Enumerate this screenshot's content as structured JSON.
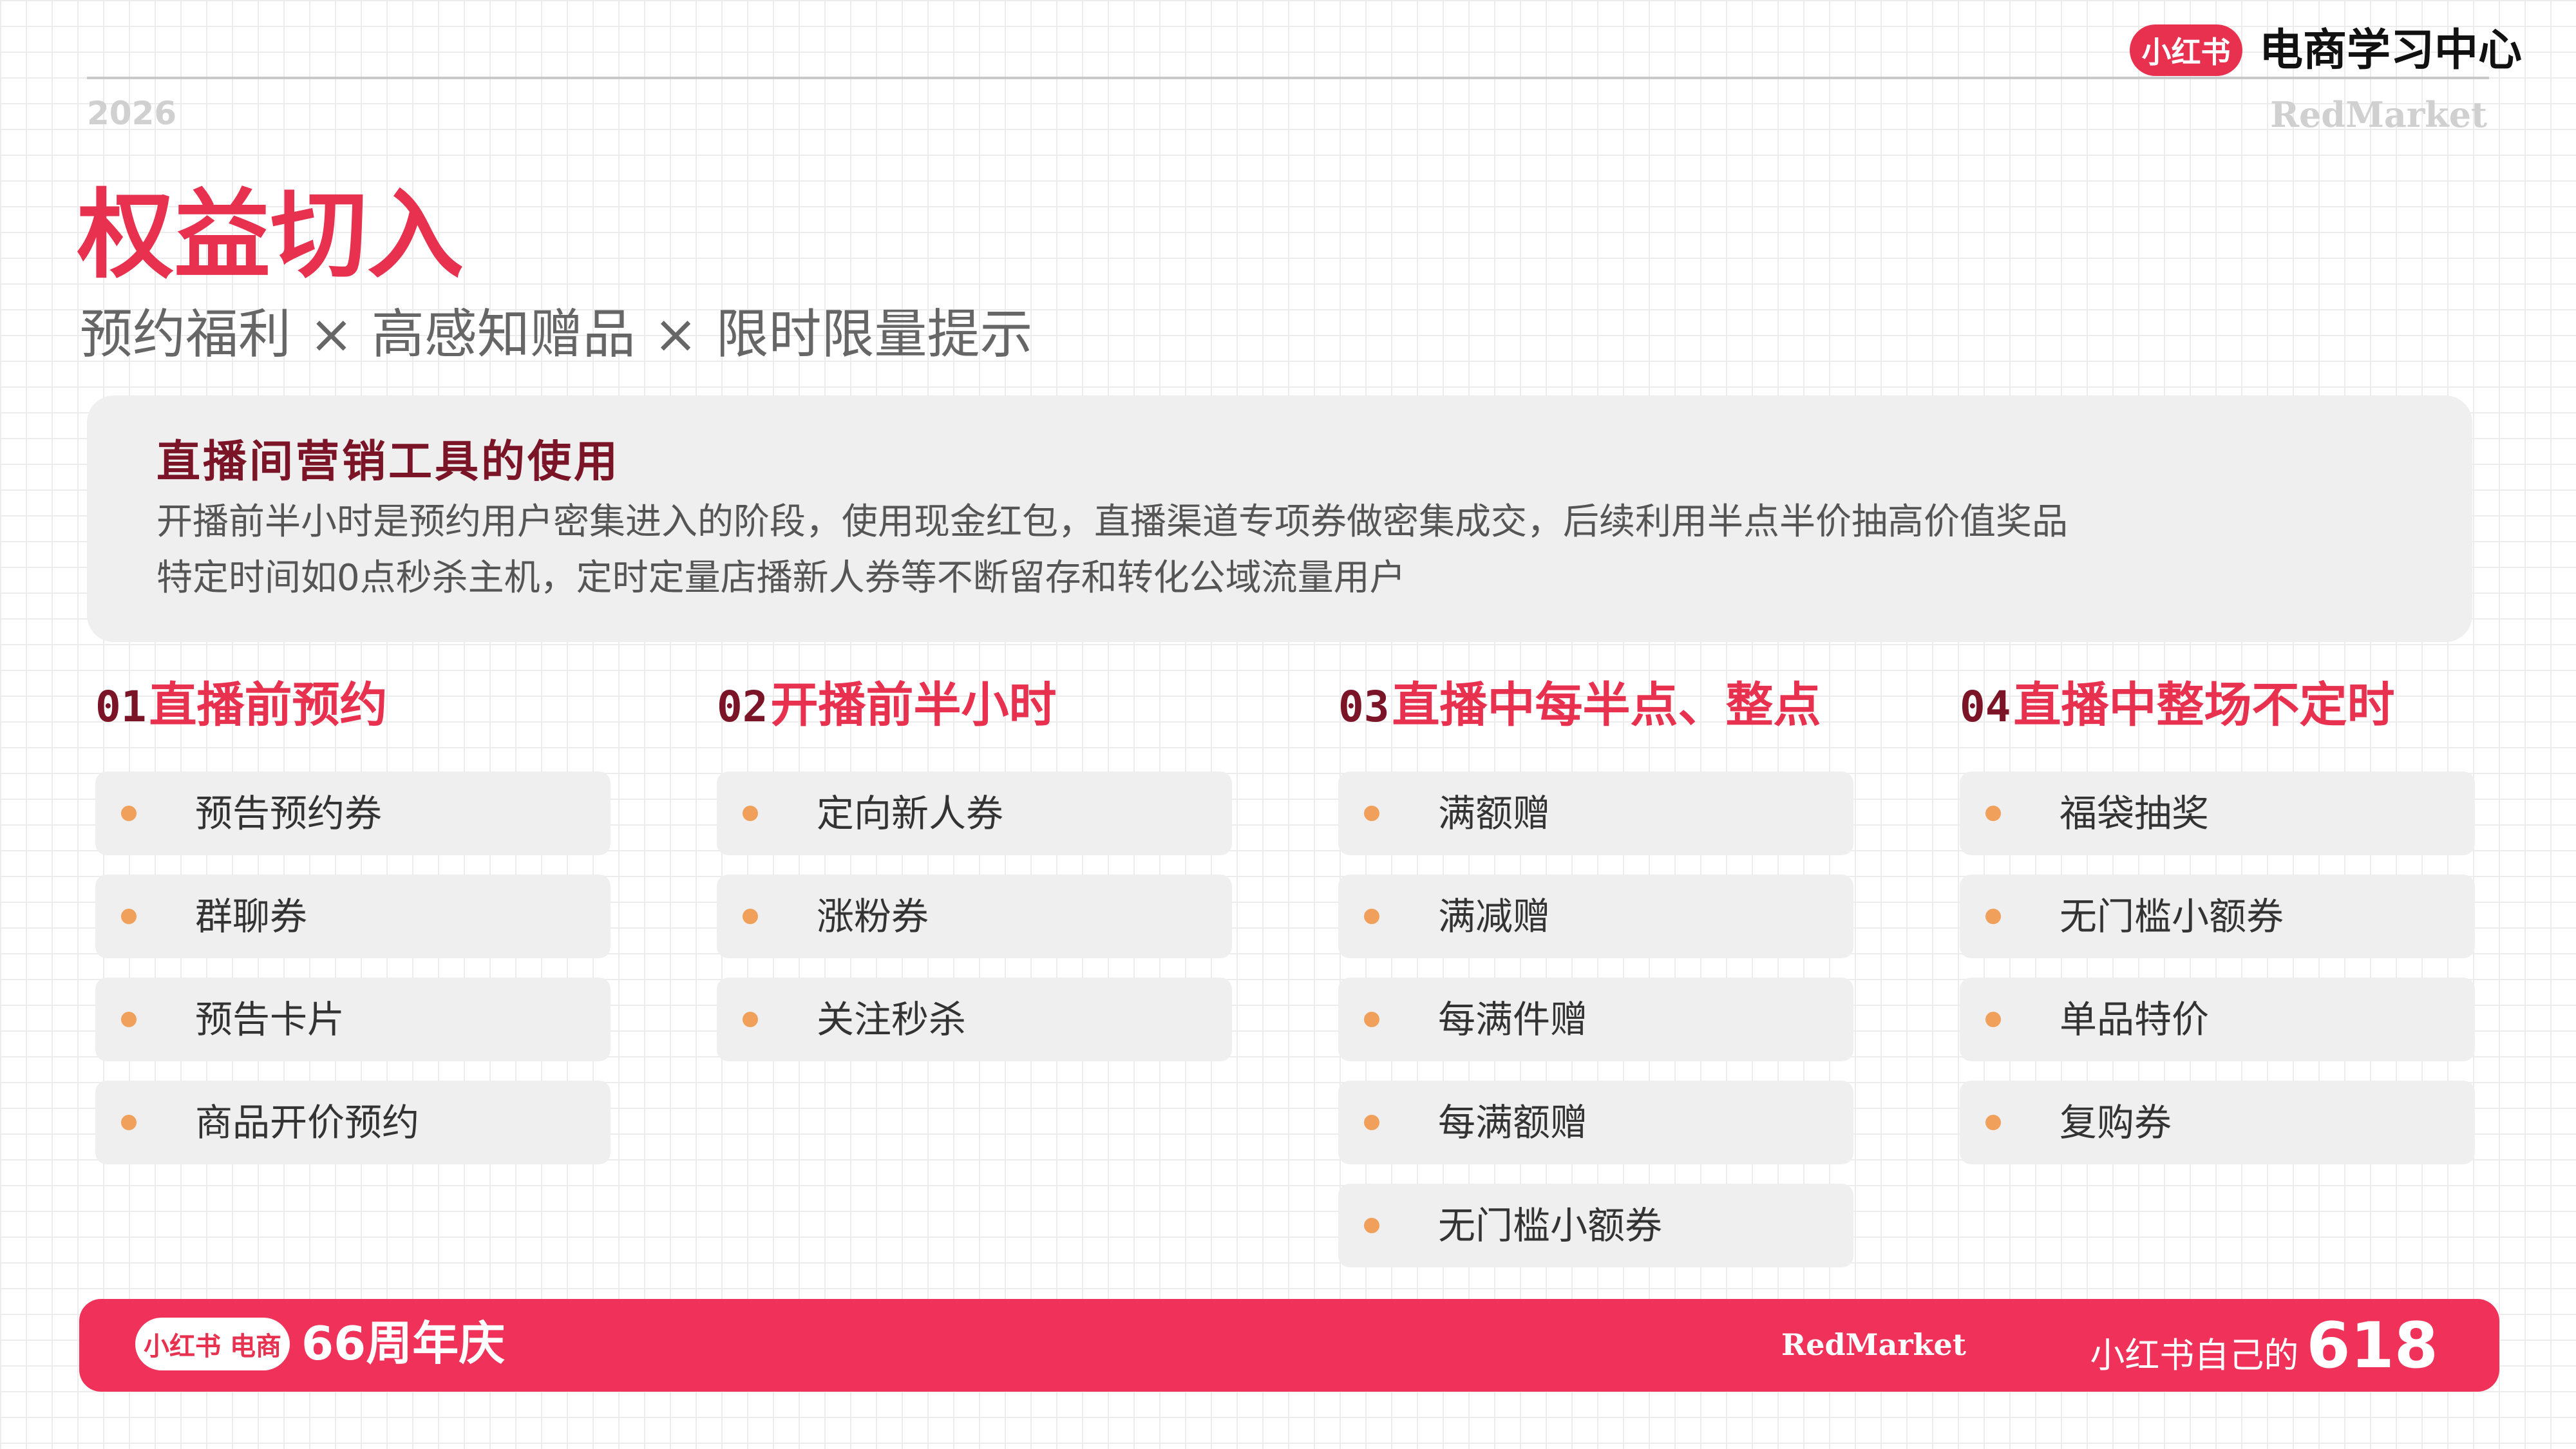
{
  "header": {
    "brand_badge": "小红书",
    "brand_title": "电商学习中心",
    "year": "2026",
    "wordmark": "RedMarket"
  },
  "page": {
    "title": "权益切入",
    "subtitle": [
      "预约福利",
      "高感知赠品",
      "限时限量提示"
    ],
    "subtitle_separator": "×"
  },
  "info_card": {
    "heading": "直播间营销工具的使用",
    "line1": "开播前半小时是预约用户密集进入的阶段，使用现金红包，直播渠道专项券做密集成交，后续利用半点半价抽高价值奖品",
    "line2": "特定时间如0点秒杀主机，定时定量店播新人券等不断留存和转化公域流量用户"
  },
  "columns": [
    {
      "num": "01",
      "title": "直播前预约",
      "items": [
        "预告预约券",
        "群聊券",
        "预告卡片",
        "商品开价预约"
      ]
    },
    {
      "num": "02",
      "title": "开播前半小时",
      "items": [
        "定向新人券",
        "涨粉券",
        "关注秒杀"
      ]
    },
    {
      "num": "03",
      "title": "直播中每半点、整点",
      "items": [
        "满额赠",
        "满减赠",
        "每满件赠",
        "每满额赠",
        "无门槛小额券"
      ]
    },
    {
      "num": "04",
      "title": "直播中整场不定时",
      "items": [
        "福袋抽奖",
        "无门槛小额券",
        "单品特价",
        "复购券"
      ]
    }
  ],
  "footer": {
    "badge": "小红书 电商",
    "anniversary": "66周年庆",
    "brand": "RedMarket",
    "slogan_text": "小红书自己的",
    "slogan_number": "618"
  },
  "colors": {
    "accent": "#e8304f",
    "dark_red": "#7a1426",
    "bullet": "#f0a05a",
    "card_bg": "#efefef"
  }
}
